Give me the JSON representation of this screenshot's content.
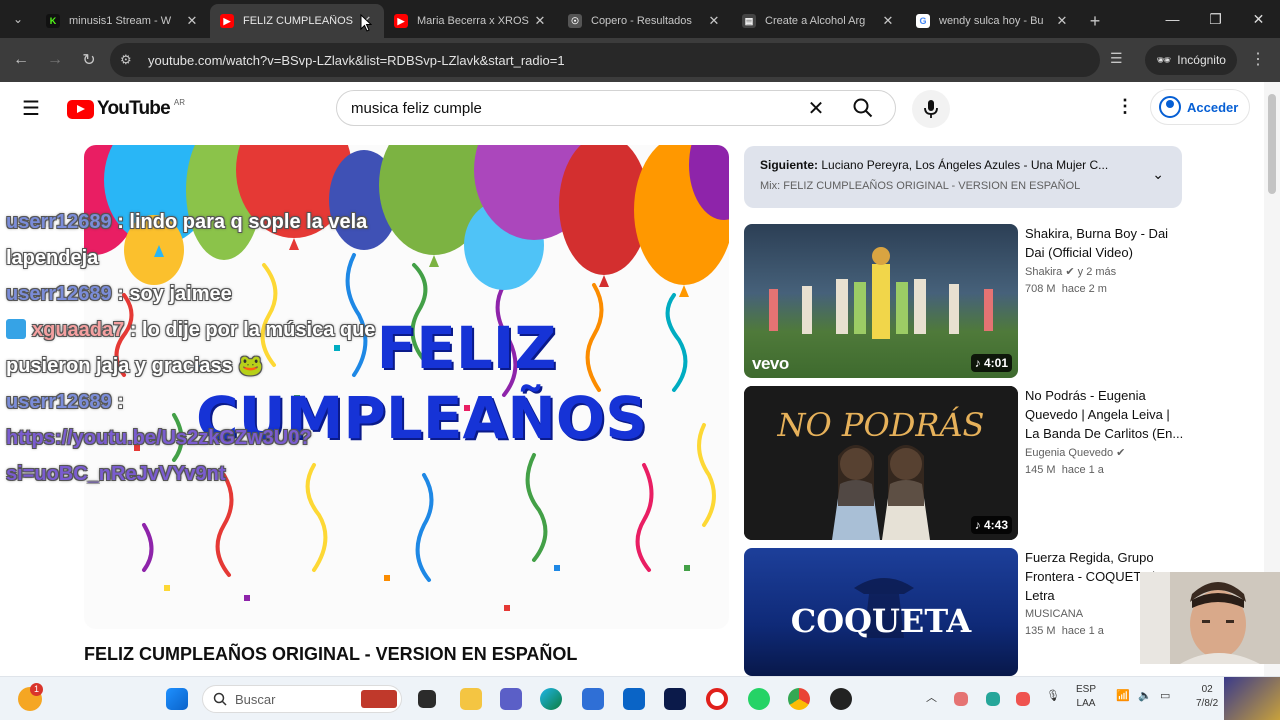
{
  "browser": {
    "tabs": [
      {
        "title": "minusis1 Stream - W",
        "favicon": "kick-icon",
        "color": "#53fc18",
        "active": false
      },
      {
        "title": "FELIZ CUMPLEAÑOS",
        "favicon": "youtube-icon",
        "color": "#ff0000",
        "active": true
      },
      {
        "title": "Maria Becerra x XROS",
        "favicon": "youtube-icon",
        "color": "#ff0000",
        "active": false
      },
      {
        "title": "Copero - Resultados",
        "favicon": "copero-icon",
        "color": "#888888",
        "active": false
      },
      {
        "title": "Create a Alcohol Arg",
        "favicon": "doc-icon",
        "color": "#888888",
        "active": false
      },
      {
        "title": "wendy sulca hoy - Bu",
        "favicon": "google-icon",
        "color": "#4285f4",
        "active": false
      }
    ],
    "url": "youtube.com/watch?v=BSvp-LZlavk&list=RDBSvp-LZlavk&start_radio=1",
    "incognito_label": "Incógnito"
  },
  "youtube": {
    "logo_text": "YouTube",
    "country_code": "AR",
    "search_query": "musica feliz cumple",
    "signin_label": "Acceder",
    "video_title": "FELIZ CUMPLEAÑOS ORIGINAL - VERSION EN ESPAÑOL",
    "video_overlay_line1": "FELIZ",
    "video_overlay_line2": "CUMPLEAÑOS",
    "up_next": {
      "prefix": "Siguiente:",
      "title": "Luciano Pereyra, Los Ángeles Azules - Una Mujer C...",
      "mix": "Mix: FELIZ CUMPLEAÑOS ORIGINAL - VERSION EN ESPAÑOL"
    },
    "recommendations": [
      {
        "title": "Shakira, Burna Boy - Dai Dai (Official Video)",
        "channel": "Shakira",
        "verified": true,
        "age_inline": "y 2 más",
        "views": "708 M",
        "age": "hace 2 m",
        "duration": "4:01",
        "thumb_text": "vevo"
      },
      {
        "title": "No Podrás - Eugenia Quevedo | Angela Leiva | La Banda De Carlitos (En...",
        "channel": "Eugenia Quevedo",
        "verified": true,
        "age_inline": "",
        "views": "145 M",
        "age": "hace 1 a",
        "duration": "4:43",
        "thumb_text": "NO PODRÁS"
      },
      {
        "title": "Fuerza Regida, Grupo Frontera - COQUETA | Letra",
        "channel": "MUSICANA",
        "verified": false,
        "age_inline": "",
        "views": "135 M",
        "age": "hace 1 a",
        "duration": "",
        "thumb_text": "COQUETA"
      }
    ]
  },
  "chat": [
    {
      "user": "userr12689",
      "message": ": lindo para q sople la vela"
    },
    {
      "user": "",
      "message": "lapendeja"
    },
    {
      "user": "userr12689",
      "message": ": soy jaimee"
    },
    {
      "user": "xguaada7",
      "message": ": lo dije por la música que"
    },
    {
      "user": "",
      "message": "pusieron jaja y graciass"
    },
    {
      "user": "userr12689",
      "message": ":"
    },
    {
      "user": "",
      "message": "https://youtu.be/Us2zkGZw3U0?",
      "link": true
    },
    {
      "user": "",
      "message": "si=uoBC_nReJvVYv9nt",
      "link": true
    }
  ],
  "taskbar": {
    "weather_badge": "1",
    "search_placeholder": "Buscar",
    "lang_top": "ESP",
    "lang_bottom": "LAA",
    "time": "02",
    "date": "7/8/2"
  }
}
